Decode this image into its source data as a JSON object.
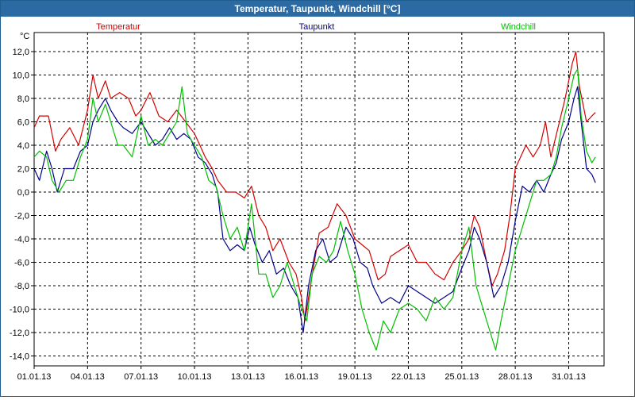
{
  "window": {
    "title": "Temperatur, Taupunkt, Windchill [°C]"
  },
  "chart_data": {
    "type": "line",
    "title": "Temperatur, Taupunkt, Windchill [°C]",
    "ylabel": "°C",
    "xlabel": "",
    "ylim": [
      -15,
      13
    ],
    "xlim": [
      0,
      31
    ],
    "yticks": [
      12,
      10,
      8,
      6,
      4,
      2,
      0,
      -2,
      -4,
      -6,
      -8,
      -10,
      -12,
      -14
    ],
    "ytick_labels": [
      "12,0",
      "10,0",
      "8,0",
      "6,0",
      "4,0",
      "2,0",
      "0,0",
      "-2,0",
      "-4,0",
      "-6,0",
      "-8,0",
      "-10,0",
      "-12,0",
      "-14,0"
    ],
    "xtick_days": [
      0,
      3,
      6,
      9,
      12,
      15,
      18,
      21,
      24,
      27,
      30
    ],
    "xtick_labels": [
      "01.01.13",
      "04.01.13",
      "07.01.13",
      "10.01.13",
      "13.01.13",
      "16.01.13",
      "19.01.13",
      "22.01.13",
      "25.01.13",
      "28.01.13",
      "31.01.13"
    ],
    "grid": true,
    "legend_placement": "top",
    "series": [
      {
        "name": "Temperatur",
        "color": "#d40000",
        "points": [
          [
            0,
            5.5
          ],
          [
            0.3,
            6.5
          ],
          [
            0.8,
            6.5
          ],
          [
            1.2,
            3.5
          ],
          [
            1.5,
            4.5
          ],
          [
            2.0,
            5.5
          ],
          [
            2.5,
            4.0
          ],
          [
            3.0,
            7.0
          ],
          [
            3.3,
            10.0
          ],
          [
            3.6,
            8.0
          ],
          [
            4.0,
            9.5
          ],
          [
            4.3,
            8.0
          ],
          [
            4.8,
            8.5
          ],
          [
            5.3,
            8.0
          ],
          [
            5.7,
            6.5
          ],
          [
            6.0,
            7.0
          ],
          [
            6.5,
            8.5
          ],
          [
            7.0,
            6.5
          ],
          [
            7.5,
            6.0
          ],
          [
            8.0,
            7.0
          ],
          [
            8.5,
            6.0
          ],
          [
            9.0,
            5.0
          ],
          [
            9.3,
            4.0
          ],
          [
            9.6,
            3.0
          ],
          [
            10.0,
            2.0
          ],
          [
            10.3,
            1.0
          ],
          [
            10.8,
            0.0
          ],
          [
            11.3,
            0.0
          ],
          [
            11.8,
            -0.5
          ],
          [
            12.2,
            0.5
          ],
          [
            12.6,
            -2.0
          ],
          [
            13.0,
            -3.0
          ],
          [
            13.4,
            -5.0
          ],
          [
            13.8,
            -4.0
          ],
          [
            14.3,
            -6.0
          ],
          [
            14.7,
            -7.0
          ],
          [
            15.0,
            -9.0
          ],
          [
            15.2,
            -11.0
          ],
          [
            15.5,
            -8.0
          ],
          [
            16.0,
            -3.5
          ],
          [
            16.5,
            -3.0
          ],
          [
            17.0,
            -1.0
          ],
          [
            17.5,
            -2.0
          ],
          [
            18.0,
            -4.0
          ],
          [
            18.4,
            -4.5
          ],
          [
            18.8,
            -5.0
          ],
          [
            19.3,
            -7.5
          ],
          [
            19.7,
            -7.0
          ],
          [
            20.0,
            -5.5
          ],
          [
            20.5,
            -5.0
          ],
          [
            21.0,
            -4.5
          ],
          [
            21.5,
            -6.0
          ],
          [
            22.0,
            -6.0
          ],
          [
            22.5,
            -7.0
          ],
          [
            23.0,
            -7.5
          ],
          [
            23.5,
            -6.0
          ],
          [
            24.0,
            -5.0
          ],
          [
            24.4,
            -4.0
          ],
          [
            24.7,
            -2.0
          ],
          [
            25.0,
            -3.0
          ],
          [
            25.4,
            -6.0
          ],
          [
            25.7,
            -8.0
          ],
          [
            26.0,
            -7.0
          ],
          [
            26.4,
            -5.0
          ],
          [
            26.7,
            -2.0
          ],
          [
            27.0,
            2.0
          ],
          [
            27.3,
            3.0
          ],
          [
            27.6,
            4.0
          ],
          [
            28.0,
            3.0
          ],
          [
            28.4,
            4.0
          ],
          [
            28.7,
            6.0
          ],
          [
            29.0,
            3.0
          ],
          [
            29.4,
            5.5
          ],
          [
            29.8,
            8.0
          ],
          [
            30.2,
            11.0
          ],
          [
            30.4,
            12.0
          ],
          [
            30.6,
            9.0
          ],
          [
            30.8,
            7.5
          ],
          [
            31.0,
            6.0
          ],
          [
            31.3,
            6.5
          ],
          [
            31.5,
            6.8
          ]
        ]
      },
      {
        "name": "Taupunkt",
        "color": "#00008b",
        "points": [
          [
            0,
            2.0
          ],
          [
            0.3,
            1.0
          ],
          [
            0.7,
            3.5
          ],
          [
            1.0,
            2.0
          ],
          [
            1.3,
            0.0
          ],
          [
            1.7,
            2.0
          ],
          [
            2.2,
            2.0
          ],
          [
            2.6,
            3.5
          ],
          [
            3.0,
            4.0
          ],
          [
            3.3,
            6.0
          ],
          [
            3.6,
            7.0
          ],
          [
            4.0,
            8.0
          ],
          [
            4.3,
            7.0
          ],
          [
            4.7,
            6.0
          ],
          [
            5.0,
            5.5
          ],
          [
            5.5,
            5.0
          ],
          [
            6.0,
            6.0
          ],
          [
            6.4,
            5.0
          ],
          [
            6.8,
            4.0
          ],
          [
            7.2,
            4.5
          ],
          [
            7.6,
            5.5
          ],
          [
            8.0,
            4.5
          ],
          [
            8.4,
            5.0
          ],
          [
            8.8,
            4.5
          ],
          [
            9.2,
            3.0
          ],
          [
            9.6,
            2.5
          ],
          [
            10.0,
            1.5
          ],
          [
            10.3,
            0.0
          ],
          [
            10.6,
            -4.0
          ],
          [
            11.0,
            -5.0
          ],
          [
            11.4,
            -4.5
          ],
          [
            11.8,
            -5.0
          ],
          [
            12.1,
            -3.0
          ],
          [
            12.4,
            -4.5
          ],
          [
            12.8,
            -6.0
          ],
          [
            13.2,
            -5.0
          ],
          [
            13.6,
            -7.0
          ],
          [
            14.0,
            -6.5
          ],
          [
            14.4,
            -8.0
          ],
          [
            14.8,
            -9.0
          ],
          [
            15.1,
            -12.0
          ],
          [
            15.4,
            -8.0
          ],
          [
            15.8,
            -5.0
          ],
          [
            16.2,
            -4.0
          ],
          [
            16.6,
            -6.0
          ],
          [
            17.0,
            -5.5
          ],
          [
            17.5,
            -3.0
          ],
          [
            17.9,
            -4.0
          ],
          [
            18.3,
            -6.0
          ],
          [
            18.7,
            -6.5
          ],
          [
            19.0,
            -8.0
          ],
          [
            19.5,
            -9.5
          ],
          [
            20.0,
            -9.0
          ],
          [
            20.5,
            -9.5
          ],
          [
            21.0,
            -8.0
          ],
          [
            21.5,
            -8.5
          ],
          [
            22.0,
            -9.0
          ],
          [
            22.5,
            -9.5
          ],
          [
            23.0,
            -9.0
          ],
          [
            23.5,
            -8.5
          ],
          [
            24.0,
            -6.5
          ],
          [
            24.4,
            -5.0
          ],
          [
            24.7,
            -3.0
          ],
          [
            25.0,
            -4.0
          ],
          [
            25.4,
            -6.0
          ],
          [
            25.8,
            -9.0
          ],
          [
            26.2,
            -8.0
          ],
          [
            26.6,
            -6.0
          ],
          [
            27.0,
            -2.5
          ],
          [
            27.4,
            0.5
          ],
          [
            27.8,
            0.0
          ],
          [
            28.2,
            1.0
          ],
          [
            28.6,
            0.0
          ],
          [
            29.0,
            1.5
          ],
          [
            29.3,
            2.5
          ],
          [
            29.6,
            4.5
          ],
          [
            30.0,
            6.0
          ],
          [
            30.3,
            8.0
          ],
          [
            30.5,
            9.0
          ],
          [
            30.7,
            6.0
          ],
          [
            31.0,
            2.0
          ],
          [
            31.3,
            1.5
          ],
          [
            31.5,
            0.8
          ]
        ]
      },
      {
        "name": "Windchill",
        "color": "#00c000",
        "points": [
          [
            0,
            3.0
          ],
          [
            0.3,
            3.5
          ],
          [
            0.7,
            3.0
          ],
          [
            1.0,
            1.0
          ],
          [
            1.4,
            0.0
          ],
          [
            1.8,
            1.0
          ],
          [
            2.2,
            1.0
          ],
          [
            2.6,
            3.0
          ],
          [
            3.0,
            4.5
          ],
          [
            3.3,
            8.0
          ],
          [
            3.6,
            6.0
          ],
          [
            4.0,
            7.5
          ],
          [
            4.3,
            6.0
          ],
          [
            4.7,
            4.0
          ],
          [
            5.0,
            4.0
          ],
          [
            5.5,
            3.0
          ],
          [
            6.0,
            6.5
          ],
          [
            6.4,
            4.0
          ],
          [
            6.8,
            4.5
          ],
          [
            7.2,
            4.0
          ],
          [
            7.6,
            5.0
          ],
          [
            8.0,
            6.0
          ],
          [
            8.3,
            9.0
          ],
          [
            8.6,
            5.0
          ],
          [
            9.0,
            4.0
          ],
          [
            9.4,
            3.0
          ],
          [
            9.8,
            1.0
          ],
          [
            10.2,
            0.5
          ],
          [
            10.6,
            -2.0
          ],
          [
            11.0,
            -4.0
          ],
          [
            11.4,
            -3.0
          ],
          [
            11.8,
            -5.0
          ],
          [
            12.2,
            -1.0
          ],
          [
            12.6,
            -7.0
          ],
          [
            13.0,
            -7.0
          ],
          [
            13.4,
            -9.0
          ],
          [
            13.8,
            -8.0
          ],
          [
            14.2,
            -6.0
          ],
          [
            14.6,
            -8.0
          ],
          [
            15.0,
            -10.0
          ],
          [
            15.3,
            -11.0
          ],
          [
            15.6,
            -7.0
          ],
          [
            16.0,
            -5.5
          ],
          [
            16.4,
            -6.0
          ],
          [
            16.8,
            -5.0
          ],
          [
            17.2,
            -2.5
          ],
          [
            17.6,
            -5.0
          ],
          [
            18.0,
            -7.0
          ],
          [
            18.4,
            -10.0
          ],
          [
            18.8,
            -12.0
          ],
          [
            19.2,
            -13.5
          ],
          [
            19.6,
            -11.0
          ],
          [
            20.0,
            -12.0
          ],
          [
            20.5,
            -10.0
          ],
          [
            21.0,
            -9.5
          ],
          [
            21.5,
            -10.0
          ],
          [
            22.0,
            -11.0
          ],
          [
            22.5,
            -9.0
          ],
          [
            23.0,
            -10.0
          ],
          [
            23.5,
            -9.0
          ],
          [
            24.0,
            -5.0
          ],
          [
            24.4,
            -3.0
          ],
          [
            24.8,
            -8.0
          ],
          [
            25.2,
            -10.0
          ],
          [
            25.6,
            -12.0
          ],
          [
            25.9,
            -13.5
          ],
          [
            26.2,
            -11.0
          ],
          [
            26.6,
            -8.0
          ],
          [
            27.0,
            -5.0
          ],
          [
            27.4,
            -3.0
          ],
          [
            27.8,
            -1.0
          ],
          [
            28.2,
            1.0
          ],
          [
            28.6,
            1.0
          ],
          [
            29.0,
            1.5
          ],
          [
            29.3,
            3.0
          ],
          [
            29.6,
            5.5
          ],
          [
            30.0,
            8.0
          ],
          [
            30.3,
            10.0
          ],
          [
            30.5,
            10.5
          ],
          [
            30.7,
            6.5
          ],
          [
            31.0,
            3.5
          ],
          [
            31.3,
            2.5
          ],
          [
            31.5,
            3.0
          ]
        ]
      }
    ]
  }
}
